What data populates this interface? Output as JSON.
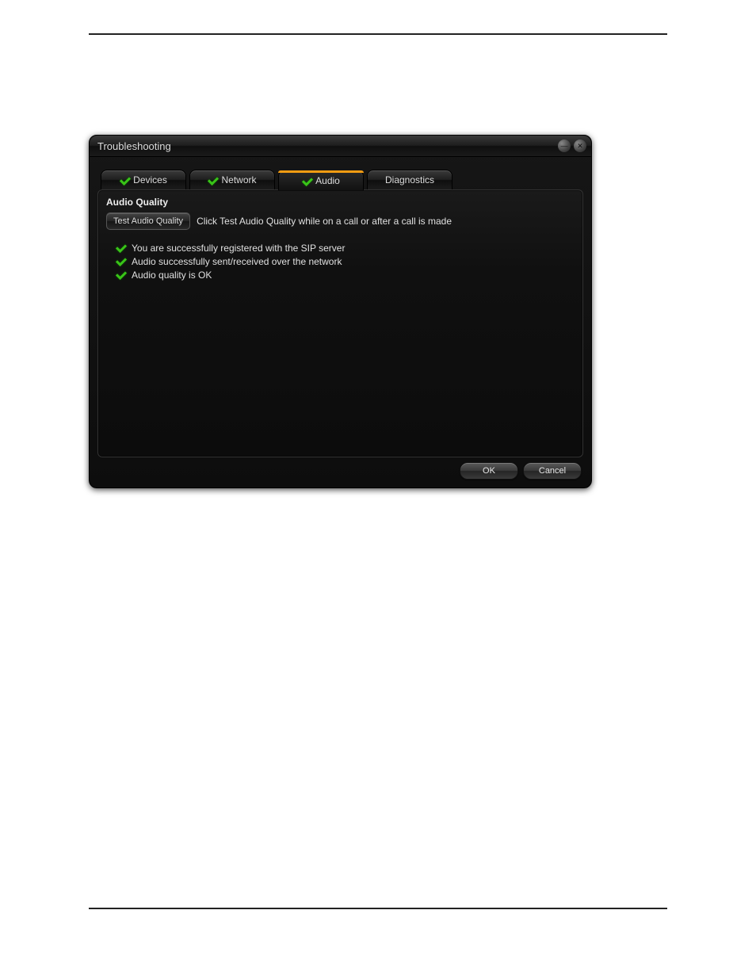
{
  "dialog": {
    "title": "Troubleshooting"
  },
  "tabs": [
    {
      "label": "Devices",
      "has_check": true,
      "active": false
    },
    {
      "label": "Network",
      "has_check": true,
      "active": false
    },
    {
      "label": "Audio",
      "has_check": true,
      "active": true
    },
    {
      "label": "Diagnostics",
      "has_check": false,
      "active": false
    }
  ],
  "audio_panel": {
    "section_title": "Audio Quality",
    "test_button": "Test Audio Quality",
    "hint": "Click Test Audio Quality while on a call or after a call is made",
    "statuses": [
      "You are successfully registered with the SIP server",
      "Audio successfully sent/received over the network",
      "Audio quality is OK"
    ]
  },
  "footer": {
    "ok": "OK",
    "cancel": "Cancel"
  }
}
